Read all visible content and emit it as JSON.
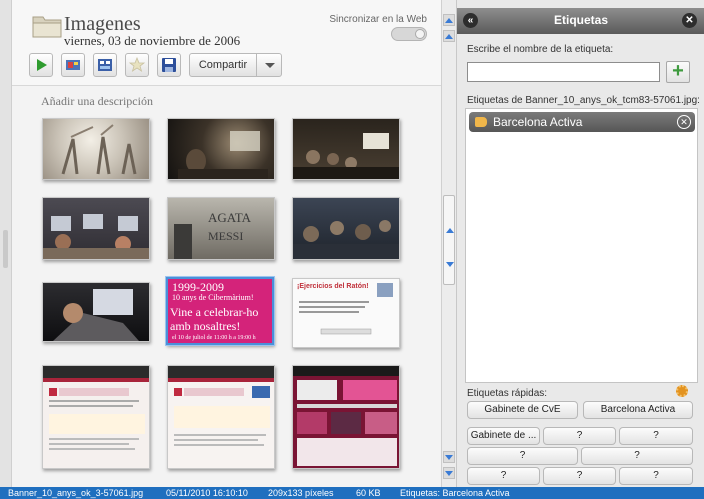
{
  "album": {
    "title": "Imagenes",
    "date": "viernes, 03 de noviembre de 2006",
    "sync_label": "Sincronizar en la Web",
    "description_placeholder": "Añadir una descripción"
  },
  "toolbar": {
    "share_label": "Compartir",
    "icons": [
      "play-icon",
      "slideshow-icon",
      "collage-icon",
      "star-icon",
      "save-icon"
    ]
  },
  "thumbnails": [
    {
      "name": "photo-dance-performance",
      "text_lines": []
    },
    {
      "name": "photo-conference-room",
      "text_lines": []
    },
    {
      "name": "photo-computer-class-dark",
      "text_lines": []
    },
    {
      "name": "photo-computer-lab",
      "text_lines": []
    },
    {
      "name": "photo-exhibition-wall",
      "text_lines": []
    },
    {
      "name": "photo-seated-audience",
      "text_lines": []
    },
    {
      "name": "photo-keyboard-user",
      "text_lines": []
    },
    {
      "name": "banner-10-anys",
      "selected": true,
      "text_lines": [
        "1999-2009",
        "10 anys de Cibermàrium!",
        "Vine a celebrar-ho",
        "amb nosaltres!",
        "el 10 de juliol de 11:00 h a 19:00 h"
      ]
    },
    {
      "name": "ejercicios-raton",
      "text_lines": [
        "¡Ejercicios del Ratón!"
      ]
    },
    {
      "name": "screenshot-barcelona-activa-1",
      "text_lines": []
    },
    {
      "name": "screenshot-barcelona-activa-2",
      "text_lines": []
    },
    {
      "name": "screenshot-barcelona-activa-3",
      "text_lines": []
    }
  ],
  "tags_panel": {
    "title": "Etiquetas",
    "input_label": "Escribe el nombre de la etiqueta:",
    "file_tags_label": "Etiquetas de Banner_10_anys_ok_tcm83-57061.jpg:",
    "current_tags": [
      "Barcelona Activa"
    ],
    "quick_label": "Etiquetas rápidas:",
    "quick_tags": [
      "Gabinete de CvE",
      "Barcelona Activa",
      "Gabinete de ...",
      "?",
      "?",
      "?",
      "?",
      "?",
      "?",
      "?"
    ]
  },
  "status": {
    "filename": "Banner_10_anys_ok_3-57061.jpg",
    "datetime": "05/11/2010 16:10:10",
    "dimensions": "209x133 píxeles",
    "size": "60 KB",
    "tags": "Etiquetas: Barcelona Activa"
  },
  "colors": {
    "accent_blue": "#1f6fbf",
    "panel_header": "#6e6e6e",
    "selection": "#4a90d9",
    "add_green": "#3f9b3f"
  }
}
